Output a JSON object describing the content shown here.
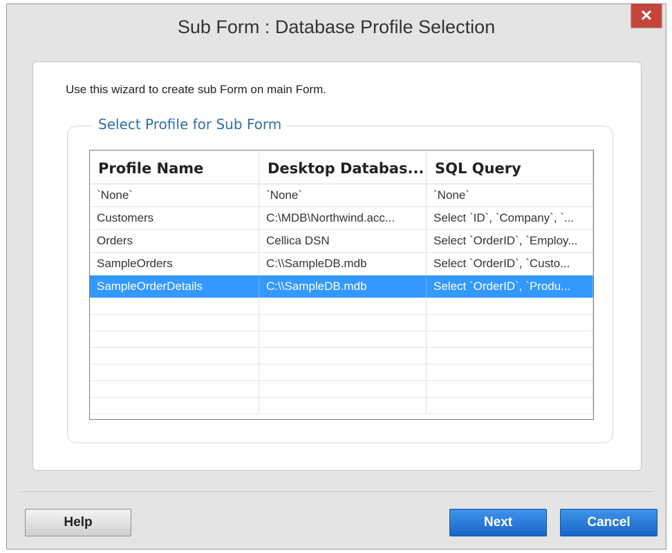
{
  "window": {
    "title": "Sub Form : Database Profile Selection",
    "close_glyph": "✕"
  },
  "intro_text": "Use this wizard to create sub Form on main Form.",
  "group": {
    "legend": "Select Profile for Sub Form"
  },
  "grid": {
    "columns": [
      "Profile Name",
      "Desktop Databas...",
      "SQL Query"
    ],
    "rows": [
      {
        "profile": "`None`",
        "database": "`None`",
        "query": "`None`"
      },
      {
        "profile": "Customers",
        "database": "C:\\MDB\\Northwind.acc...",
        "query": "Select `ID`, `Company`, `..."
      },
      {
        "profile": "Orders",
        "database": "Cellica DSN",
        "query": "Select `OrderID`, `Employ..."
      },
      {
        "profile": "SampleOrders",
        "database": "C:\\\\SampleDB.mdb",
        "query": "Select `OrderID`, `Custo..."
      },
      {
        "profile": "SampleOrderDetails",
        "database": "C:\\\\SampleDB.mdb",
        "query": "Select `OrderID`, `Produ..."
      }
    ],
    "selected_row": 4
  },
  "buttons": {
    "help": "Help",
    "next": "Next",
    "cancel": "Cancel"
  },
  "colors": {
    "selection": "#3399ff",
    "legend_text": "#2e6fa8",
    "primary_button": "#1a66c9",
    "close_button": "#c4453b"
  },
  "icons": {
    "close": "close-icon"
  }
}
